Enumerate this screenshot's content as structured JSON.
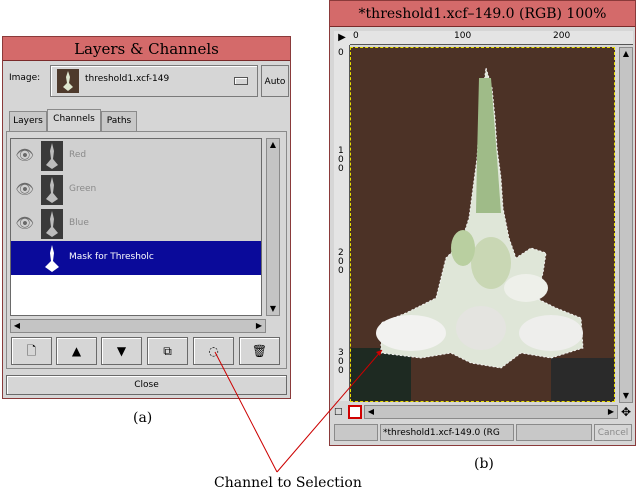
{
  "layers_dialog": {
    "title": "Layers & Channels",
    "image_label": "Image:",
    "image_name": "threshold1.xcf-149",
    "auto_label": "Auto",
    "tabs": [
      {
        "label": "Layers",
        "active": false
      },
      {
        "label": "Channels",
        "active": true
      },
      {
        "label": "Paths",
        "active": false
      }
    ],
    "channels": [
      {
        "name": "Red",
        "selected": false
      },
      {
        "name": "Green",
        "selected": false
      },
      {
        "name": "Blue",
        "selected": false
      },
      {
        "name": "Mask for Thresholc",
        "selected": true
      }
    ],
    "toolbar_icons": [
      "new-channel-icon",
      "raise-channel-icon",
      "lower-channel-icon",
      "duplicate-channel-icon",
      "channel-to-selection-icon",
      "delete-channel-icon"
    ],
    "close_label": "Close"
  },
  "image_window": {
    "title": "*threshold1.xcf–149.0 (RGB) 100%",
    "ruler_top_labels": [
      "0",
      "100",
      "200"
    ],
    "ruler_left_labels": [
      "0",
      "100",
      "200",
      "300"
    ],
    "status_text": "*threshold1.xcf-149.0 (RG",
    "cancel_label": "Cancel"
  },
  "captions": {
    "a": "(a)",
    "b": "(b)",
    "annotation": "Channel to Selection"
  },
  "colors": {
    "titlebar": "#d46a6a",
    "selection_row": "#0a0a9a",
    "selection_marching_ants": "#e8e000",
    "annotation_line": "#cc0000"
  }
}
